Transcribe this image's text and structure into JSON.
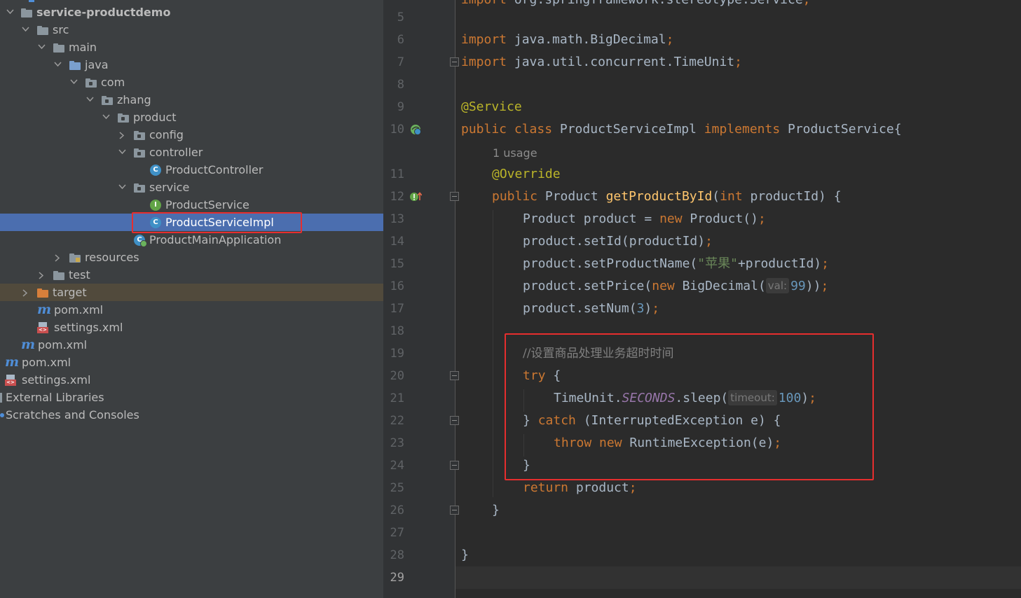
{
  "project_tree": {
    "items": [
      {
        "label": "service-productdemo",
        "icon": "module-folder-icon",
        "expanded": true
      },
      {
        "label": "src",
        "icon": "folder-icon",
        "expanded": true
      },
      {
        "label": "main",
        "icon": "folder-icon",
        "expanded": true
      },
      {
        "label": "java",
        "icon": "source-folder-icon",
        "expanded": true
      },
      {
        "label": "com",
        "icon": "package-icon",
        "expanded": true
      },
      {
        "label": "zhang",
        "icon": "package-icon",
        "expanded": true
      },
      {
        "label": "product",
        "icon": "package-icon",
        "expanded": true
      },
      {
        "label": "config",
        "icon": "package-icon",
        "expanded": false
      },
      {
        "label": "controller",
        "icon": "package-icon",
        "expanded": true
      },
      {
        "label": "ProductController",
        "icon": "class-icon"
      },
      {
        "label": "service",
        "icon": "package-icon",
        "expanded": true
      },
      {
        "label": "ProductService",
        "icon": "interface-icon"
      },
      {
        "label": "ProductServiceImpl",
        "icon": "class-icon",
        "selected": true
      },
      {
        "label": "ProductMainApplication",
        "icon": "spring-boot-class-icon"
      },
      {
        "label": "resources",
        "icon": "resources-folder-icon",
        "expanded": false
      },
      {
        "label": "test",
        "icon": "folder-icon",
        "expanded": false
      },
      {
        "label": "target",
        "icon": "excluded-folder-icon",
        "expanded": false
      },
      {
        "label": "pom.xml",
        "icon": "maven-icon"
      },
      {
        "label": "settings.xml",
        "icon": "xml-icon"
      },
      {
        "label": "pom.xml",
        "icon": "maven-icon"
      },
      {
        "label": "pom.xml",
        "icon": "maven-icon"
      },
      {
        "label": "settings.xml",
        "icon": "xml-icon"
      },
      {
        "label": "External Libraries",
        "icon": "library-icon"
      },
      {
        "label": "Scratches and Consoles",
        "icon": "scratch-icon"
      }
    ]
  },
  "editor": {
    "partial_top_line": "import org.springframework.stereotype.Service;",
    "usage_hint": "1 usage",
    "line_numbers": [
      "5",
      "6",
      "7",
      "8",
      "9",
      "10",
      "11",
      "12",
      "13",
      "14",
      "15",
      "16",
      "17",
      "18",
      "19",
      "20",
      "21",
      "22",
      "23",
      "24",
      "25",
      "26",
      "27",
      "28",
      "29"
    ],
    "current_line": "29",
    "code": {
      "l6_kw": "import",
      "l6_rest": " java.math.BigDecimal",
      "semi": ";",
      "l7_kw": "import",
      "l7_rest": " java.util.concurrent.TimeUnit",
      "l9": "@Service",
      "l10_kw": "public class",
      "l10_name": " ProductServiceImpl ",
      "l10_impl": "implements",
      "l10_rest": " ProductService{",
      "l11": "@Override",
      "l12_kw": "public",
      "l12_type": " Product ",
      "l12_fn": "getProductById",
      "l12_p1": "(",
      "l12_int": "int",
      "l12_rest": " productId) {",
      "l13_a": "Product product = ",
      "l13_new": "new",
      "l13_b": " Product()",
      "l14": "product.setId(productId)",
      "l15_a": "product.setProductName(",
      "l15_str": "\"苹果\"",
      "l15_b": "+productId)",
      "l16_a": "product.setPrice(",
      "l16_new": "new",
      "l16_b": " BigDecimal(",
      "l16_hint": "val:",
      "l16_num": "99",
      "l16_c": "))",
      "l17_a": "product.setNum(",
      "l17_num": "3",
      "l17_b": ")",
      "l19": "//设置商品处理业务超时时间",
      "l20_kw": "try",
      "l20_rest": " {",
      "l21_a": "TimeUnit.",
      "l21_const": "SECONDS",
      "l21_b": ".sleep(",
      "l21_hint": "timeout:",
      "l21_num": "100",
      "l21_c": ")",
      "l22_a": "} ",
      "l22_kw": "catch",
      "l22_b": " (InterruptedException e) {",
      "l23_kw1": "throw",
      "l23_kw2": " new",
      "l23_b": " RuntimeException(e)",
      "l24": "}",
      "l25_kw": "return",
      "l25_b": " product",
      "l26": "}",
      "l28": "}"
    }
  },
  "colors": {
    "highlight_box": "#e62e2e",
    "selection": "#4b6eaf",
    "keyword": "#cc7832",
    "annotation": "#bbb529",
    "method": "#ffc66d",
    "string": "#6a8759",
    "number": "#6897bb"
  }
}
